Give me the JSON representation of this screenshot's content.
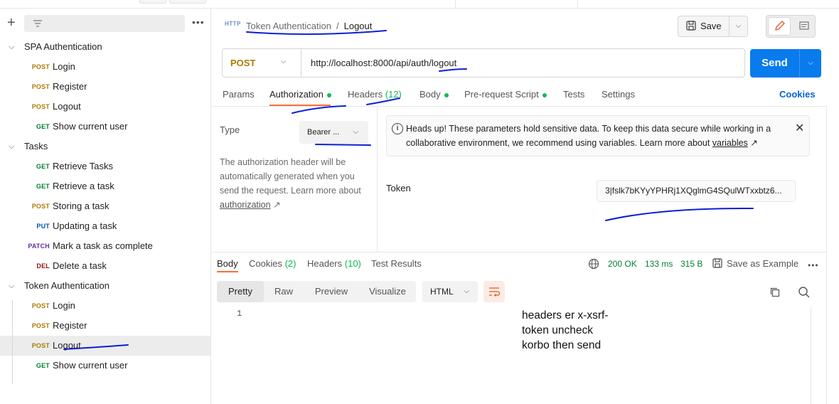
{
  "sidebar": {
    "tree": [
      {
        "type": "folder",
        "label": "SPA Authentication"
      },
      {
        "type": "request",
        "method": "POST",
        "label": "Login"
      },
      {
        "type": "request",
        "method": "POST",
        "label": "Register"
      },
      {
        "type": "request",
        "method": "POST",
        "label": "Logout"
      },
      {
        "type": "request",
        "method": "GET",
        "label": "Show current user"
      },
      {
        "type": "folder",
        "label": "Tasks"
      },
      {
        "type": "request",
        "method": "GET",
        "label": "Retrieve Tasks"
      },
      {
        "type": "request",
        "method": "GET",
        "label": "Retrieve a task"
      },
      {
        "type": "request",
        "method": "POST",
        "label": "Storing a task"
      },
      {
        "type": "request",
        "method": "PUT",
        "label": "Updating a task"
      },
      {
        "type": "request",
        "method": "PATCH",
        "label": "Mark a task as complete"
      },
      {
        "type": "request",
        "method": "DEL",
        "label": "Delete a task"
      },
      {
        "type": "folder",
        "label": "Token Authentication"
      },
      {
        "type": "request",
        "method": "POST",
        "label": "Login"
      },
      {
        "type": "request",
        "method": "POST",
        "label": "Register"
      },
      {
        "type": "request",
        "method": "POST",
        "label": "Logout",
        "active": true
      },
      {
        "type": "request",
        "method": "GET",
        "label": "Show current user"
      }
    ]
  },
  "request": {
    "icon_label": "HTTP",
    "breadcrumb_parent": "Token Authentication",
    "breadcrumb_sep": "/",
    "breadcrumb_current": "Logout",
    "save_label": "Save",
    "method": "POST",
    "url": "http://localhost:8000/api/auth/logout",
    "send_label": "Send",
    "tabs": [
      {
        "label": "Params"
      },
      {
        "label": "Authorization",
        "dot": true,
        "active": true
      },
      {
        "label": "Headers",
        "count": "(12)"
      },
      {
        "label": "Body",
        "dot": true
      },
      {
        "label": "Pre-request Script",
        "dot": true
      },
      {
        "label": "Tests"
      },
      {
        "label": "Settings"
      }
    ],
    "cookies_label": "Cookies"
  },
  "auth": {
    "type_label": "Type",
    "type_value": "Bearer ...",
    "desc_text": "The authorization header will be automatically generated when you send the request. Learn more about ",
    "desc_link": "authorization",
    "desc_arrow": "↗",
    "alert_text": "Heads up! These parameters hold sensitive data. To keep this data secure while working in a collaborative environment, we recommend using variables. Learn more about ",
    "alert_link": "variables",
    "alert_arrow": "↗",
    "token_label": "Token",
    "token_value": "3|fslk7bKYyYPHRj1XQglmG4SQulWTxxbtz6..."
  },
  "response": {
    "tabs": [
      {
        "label": "Body",
        "active": true
      },
      {
        "label": "Cookies",
        "count": "(2)"
      },
      {
        "label": "Headers",
        "count": "(10)"
      },
      {
        "label": "Test Results"
      }
    ],
    "status": "200 OK",
    "time": "133 ms",
    "size": "315 B",
    "save_example_label": "Save as Example",
    "views": [
      "Pretty",
      "Raw",
      "Preview",
      "Visualize"
    ],
    "format": "HTML",
    "line_number": "1"
  },
  "annotation": {
    "note": "headers er x-xsrf-token uncheck korbo then send"
  },
  "colors": {
    "accent": "#ff6c37",
    "send": "#097bed",
    "post": "#ad7a03",
    "get": "#007f31",
    "put": "#0053b8",
    "patch": "#623497",
    "del": "#8e1a10",
    "ok": "#007f31",
    "ink": "#0a1fd6"
  }
}
